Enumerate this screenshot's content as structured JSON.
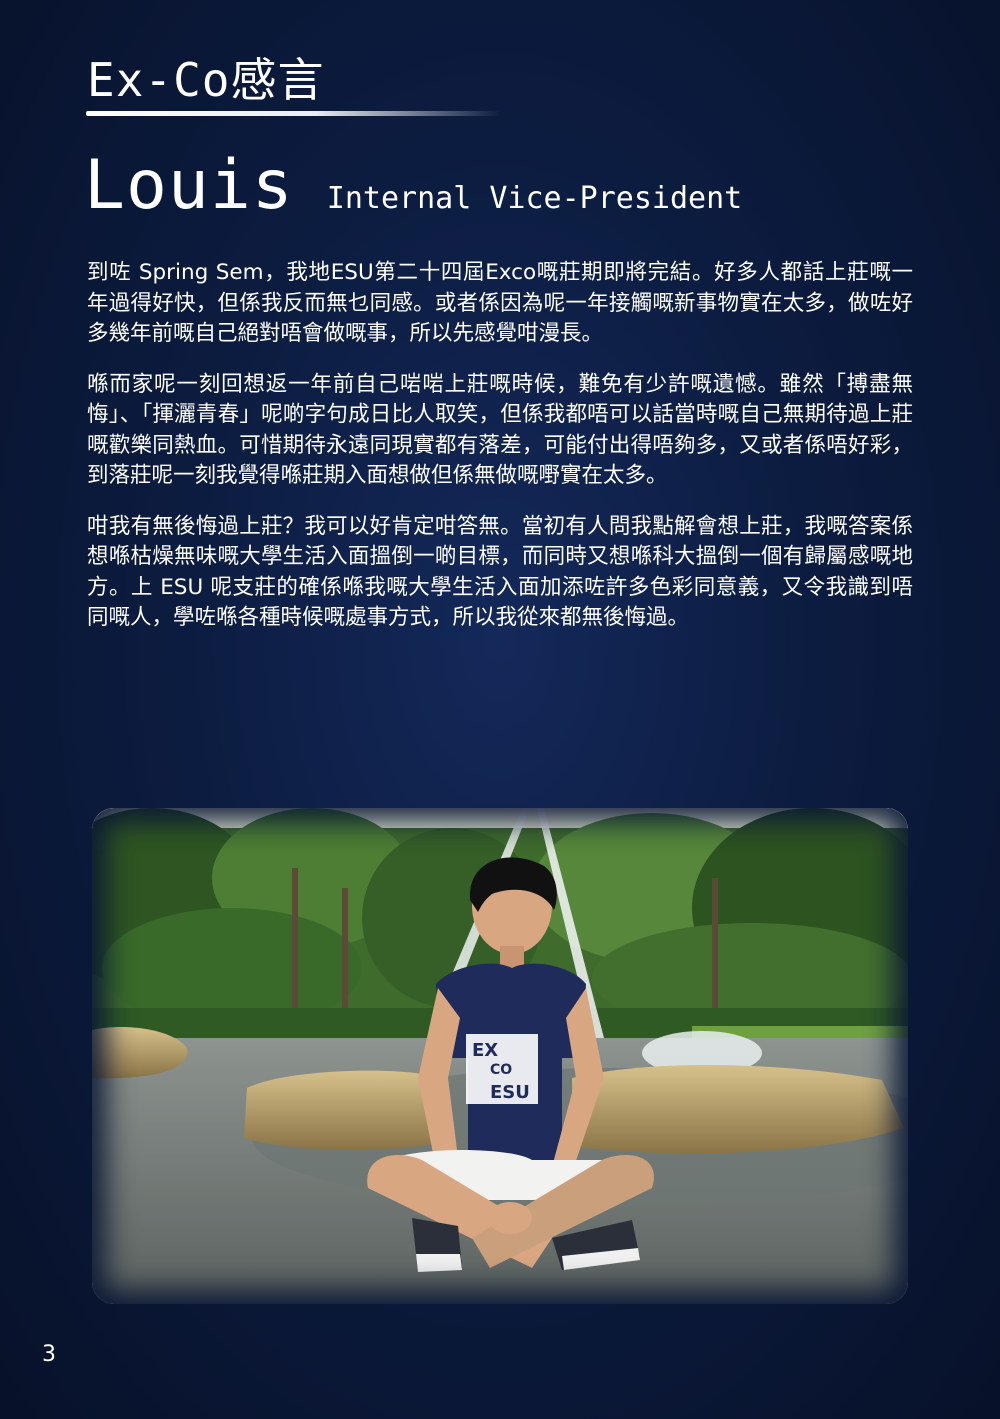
{
  "header": {
    "section_title": "Ex-Co感言"
  },
  "member": {
    "name": "Louis",
    "role": "Internal Vice-President"
  },
  "article": {
    "paragraphs": [
      "到咗 Spring Sem，我地ESU第二十四屆Exco嘅莊期即將完結。好多人都話上莊嘅一年過得好快，但係我反而無乜同感。或者係因為呢一年接觸嘅新事物實在太多，做咗好多幾年前嘅自己絕對唔會做嘅事，所以先感覺咁漫長。",
      "喺而家呢一刻回想返一年前自己啱啱上莊嘅時候，難免有少許嘅遺憾。雖然「搏盡無悔」、「揮灑青春」呢啲字句成日比人取笑，但係我都唔可以話當時嘅自己無期待過上莊嘅歡樂同熱血。可惜期待永遠同現實都有落差，可能付出得唔夠多，又或者係唔好彩，到落莊呢一刻我覺得喺莊期入面想做但係無做嘅嘢實在太多。",
      "咁我有無後悔過上莊？我可以好肯定咁答無。當初有人問我點解會想上莊，我嘅答案係想喺枯燥無味嘅大學生活入面搵倒一啲目標，而同時又想喺科大搵倒一個有歸屬感嘅地方。上 ESU 呢支莊的確係喺我嘅大學生活入面加添咗許多色彩同意義，又令我識到唔同嘅人，學咗喺各種時候嘅處事方式，所以我從來都無後悔過。"
    ]
  },
  "photo": {
    "shirt_text_line1": "EX",
    "shirt_text_line2": "CO",
    "shirt_text_line3": "ESU"
  },
  "footer": {
    "page_number": "3"
  }
}
